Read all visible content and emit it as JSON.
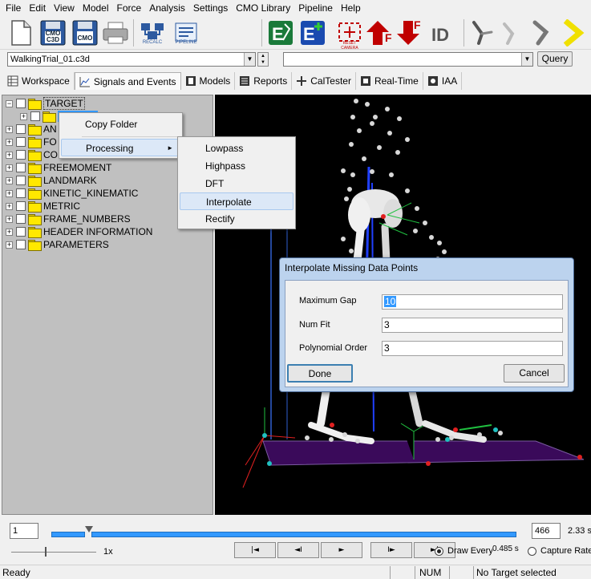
{
  "menu": [
    "File",
    "Edit",
    "View",
    "Model",
    "Force",
    "Analysis",
    "Settings",
    "CMO Library",
    "Pipeline",
    "Help"
  ],
  "toolbar": {
    "cmo_c3d_label": "CMO C3D",
    "cmo_save_label": "CMO",
    "recalc_label": "RECALC",
    "pipeline_label": "PIPELINE",
    "reset_camera_label": "RESET CAMERA",
    "force_up_label": "F",
    "force_down_label": "F",
    "id_label": "ID"
  },
  "file_combo": {
    "value": "WalkingTrial_01.c3d"
  },
  "query_combo": {
    "value": ""
  },
  "query_button": "Query",
  "tabs": [
    "Workspace",
    "Signals and Events",
    "Models",
    "Reports",
    "CalTester",
    "Real-Time",
    "IAA"
  ],
  "tree": {
    "items": [
      "TARGET",
      "AN",
      "FO",
      "CO",
      "FREEMOMENT",
      "LANDMARK",
      "KINETIC_KINEMATIC",
      "METRIC",
      "FRAME_NUMBERS",
      "HEADER INFORMATION",
      "PARAMETERS"
    ]
  },
  "context_menu": {
    "items": [
      "Copy Folder",
      "Processing"
    ]
  },
  "submenu": {
    "items": [
      "Lowpass",
      "Highpass",
      "DFT",
      "Interpolate",
      "Rectify"
    ]
  },
  "dialog": {
    "title": "Interpolate Missing Data Points",
    "fields": [
      {
        "label": "Maximum Gap",
        "value": "10"
      },
      {
        "label": "Num Fit",
        "value": "3"
      },
      {
        "label": "Polynomial Order",
        "value": "3"
      }
    ],
    "done": "Done",
    "cancel": "Cancel"
  },
  "timeline": {
    "start_frame": "1",
    "end_frame": "466",
    "end_time": "2.33 s",
    "speed": "1x",
    "draw_every_label": "Draw Every",
    "draw_every_value": "0.485 s",
    "capture_rate_label": "Capture Rate",
    "progress": 0.08,
    "playback": [
      "|◄",
      "◄I",
      "►",
      "I►",
      "►|"
    ]
  },
  "status": {
    "ready": "Ready",
    "num": "NUM",
    "target": "No Target selected"
  },
  "colors": {
    "selection_blue": "#3399ff",
    "highlight": "#dce8f7",
    "dialog_frame": "#bcd3ee",
    "force_red": "#c00000",
    "toolbar_green": "#1a7a3a",
    "toolbar_blue": "#1a4ab0"
  }
}
